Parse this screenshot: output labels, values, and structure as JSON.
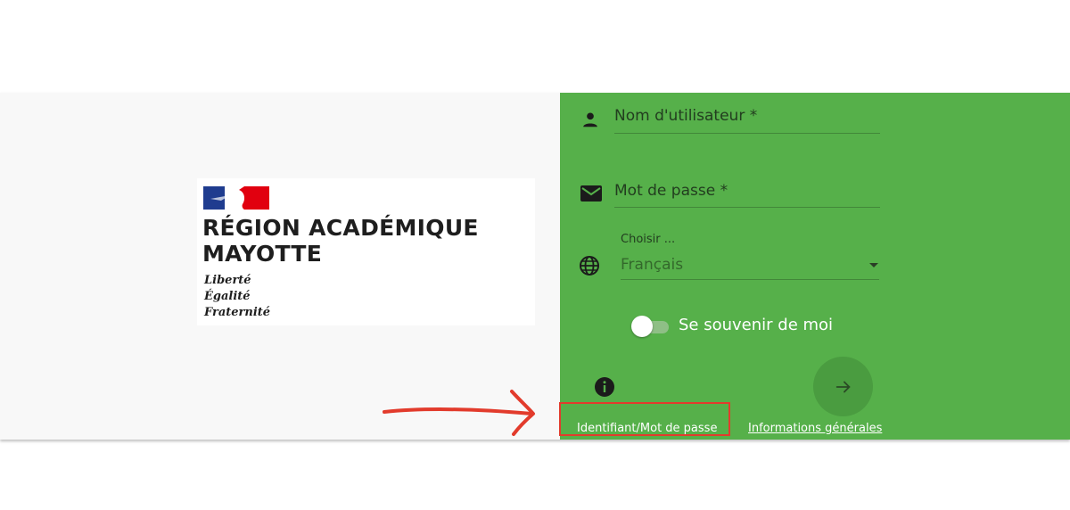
{
  "logo": {
    "title_line1": "RÉGION ACADÉMIQUE",
    "title_line2": "MAYOTTE",
    "motto": [
      "Liberté",
      "Égalité",
      "Fraternité"
    ]
  },
  "login_form": {
    "username": {
      "placeholder": "Nom d'utilisateur *",
      "value": "",
      "icon": "person-icon"
    },
    "password": {
      "placeholder": "Mot de passe *",
      "value": "",
      "icon": "email-icon"
    },
    "language": {
      "label": "Choisir ...",
      "selected": "Français",
      "icon": "globe-icon"
    },
    "remember_me": {
      "label": "Se souvenir de moi",
      "checked": false
    },
    "submit_icon": "arrow-right-icon",
    "info_icon": "info-icon",
    "links": {
      "credentials": "Identifiant/Mot de passe",
      "general_info": "Informations générales"
    }
  },
  "annotation": {
    "highlight_color": "#e23b2c",
    "arrow_color": "#e23b2c"
  },
  "colors": {
    "accent_green": "#56b04a",
    "left_bg": "#f8f8f8"
  }
}
